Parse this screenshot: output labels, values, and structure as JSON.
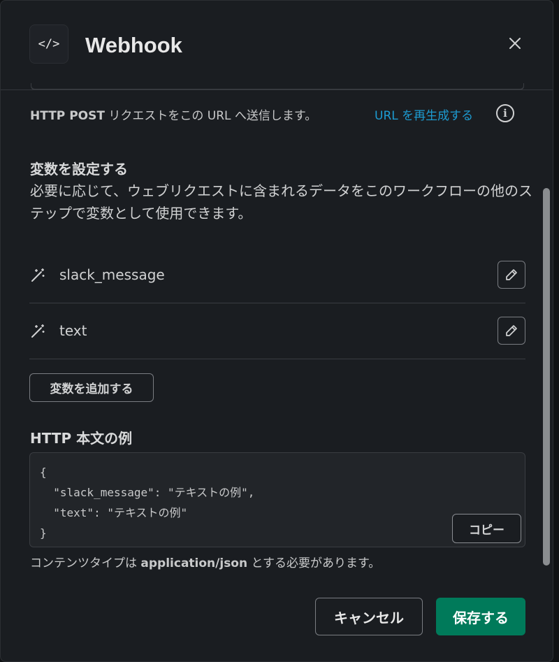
{
  "header": {
    "icon": "code-icon",
    "icon_glyph": "</>",
    "title": "Webhook",
    "close_icon": "close-icon"
  },
  "url_section": {
    "post_bold": "HTTP POST",
    "post_text": " リクエストをこの URL へ送信します。",
    "regenerate_label": "URL を再生成する",
    "info_icon": "info-icon",
    "info_glyph": "i"
  },
  "variables": {
    "title": "変数を設定する",
    "description": "必要に応じて、ウェブリクエストに含まれるデータをこのワークフローの他のステップで変数として使用できます。",
    "items": [
      {
        "name": "slack_message",
        "icon": "magic-wand-icon",
        "edit_icon": "pencil-icon"
      },
      {
        "name": "text",
        "icon": "magic-wand-icon",
        "edit_icon": "pencil-icon"
      }
    ],
    "add_label": "変数を追加する"
  },
  "http_body": {
    "title": "HTTP 本文の例",
    "code": "{\n  \"slack_message\": \"テキストの例\",\n  \"text\": \"テキストの例\"\n}",
    "copy_label": "コピー",
    "content_type_prefix": "コンテンツタイプは ",
    "content_type_bold": "application/json",
    "content_type_suffix": " とする必要があります。"
  },
  "footer": {
    "cancel_label": "キャンセル",
    "save_label": "保存する"
  },
  "colors": {
    "link": "#1d9bd1",
    "primary_button": "#007a5a",
    "background": "#1a1d21"
  }
}
